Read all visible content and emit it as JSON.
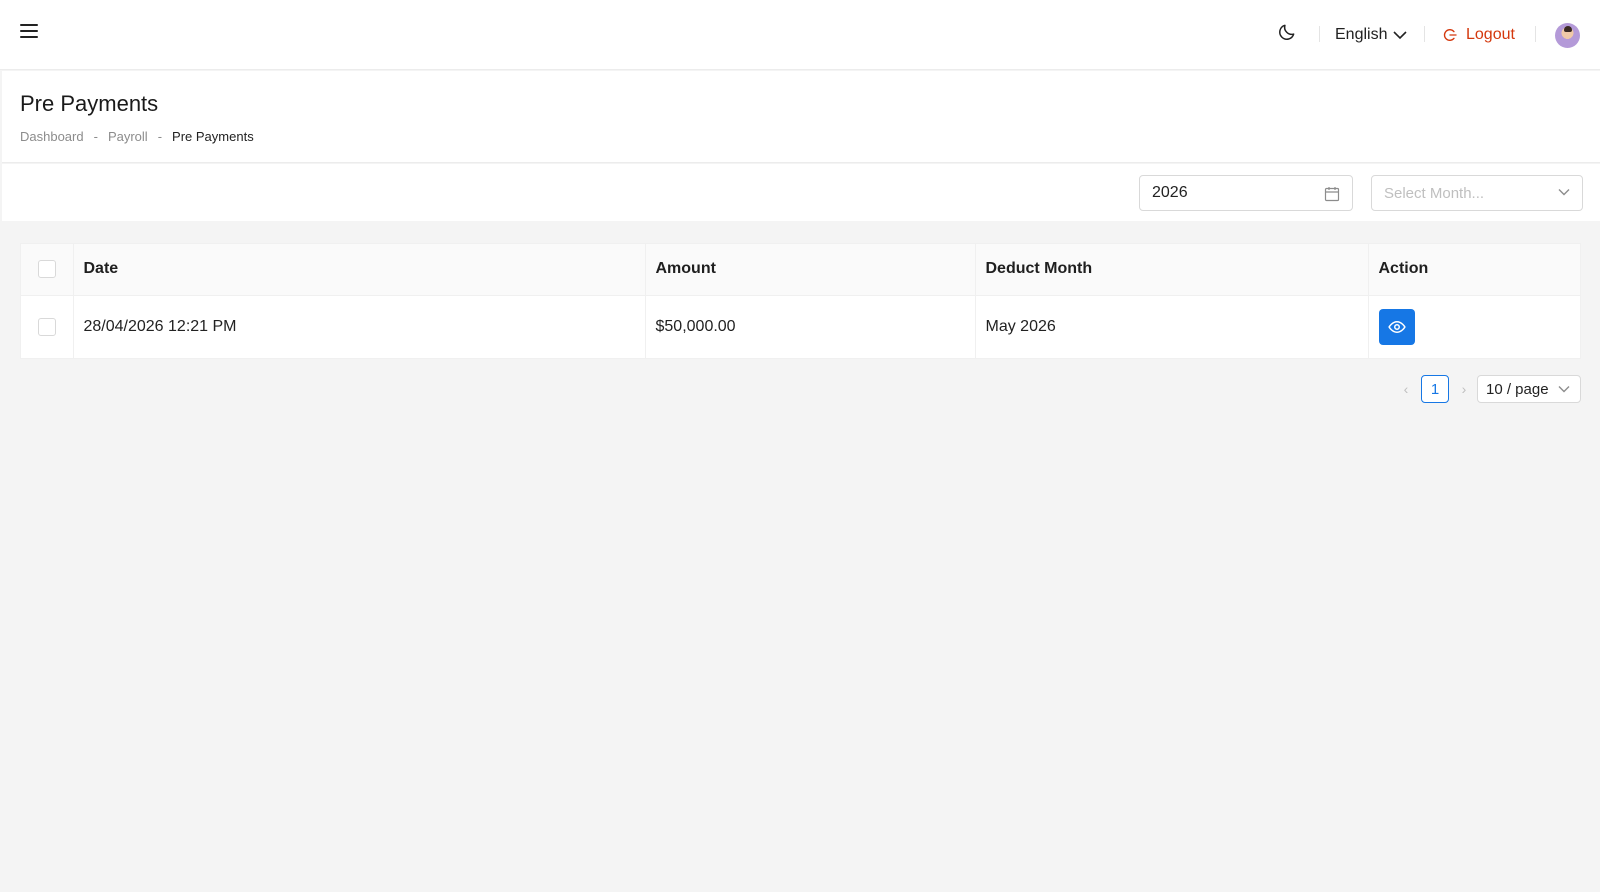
{
  "header": {
    "language": "English",
    "logout_label": "Logout"
  },
  "page": {
    "title": "Pre Payments",
    "breadcrumb": [
      {
        "label": "Dashboard"
      },
      {
        "label": "Payroll"
      },
      {
        "label": "Pre Payments"
      }
    ],
    "breadcrumb_separator": "-"
  },
  "filters": {
    "year_value": "2026",
    "month_placeholder": "Select Month..."
  },
  "table": {
    "columns": [
      "Date",
      "Amount",
      "Deduct Month",
      "Action"
    ],
    "rows": [
      {
        "date": "28/04/2026 12:21 PM",
        "amount": "$50,000.00",
        "deduct_month": "May 2026"
      }
    ]
  },
  "pagination": {
    "current_page": "1",
    "page_size": "10 / page"
  },
  "colors": {
    "primary": "#1677e5",
    "logout": "#d4380d"
  }
}
